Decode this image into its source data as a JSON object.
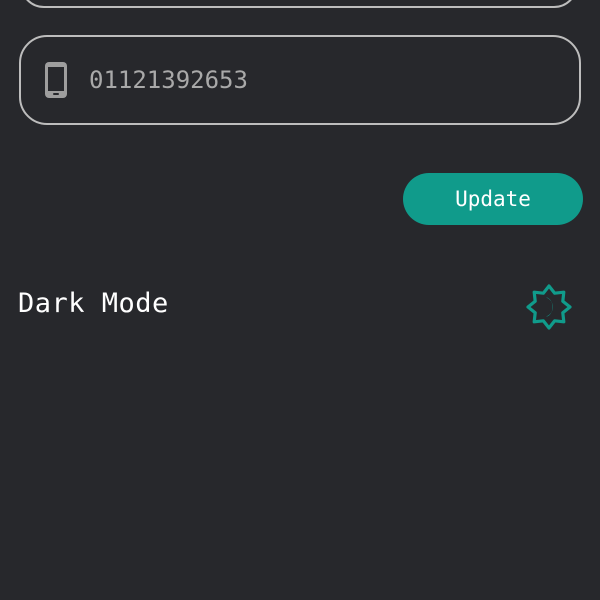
{
  "phone": {
    "value": "01121392653",
    "icon": "smartphone-icon"
  },
  "actions": {
    "update_label": "Update"
  },
  "settings": {
    "dark_mode_label": "Dark Mode",
    "dark_mode_icon": "brightness-moon-icon"
  },
  "colors": {
    "background": "#27282c",
    "accent": "#109b8b",
    "border": "#bdbdbd",
    "input_text": "#a9a9a9",
    "text": "#ffffff"
  }
}
